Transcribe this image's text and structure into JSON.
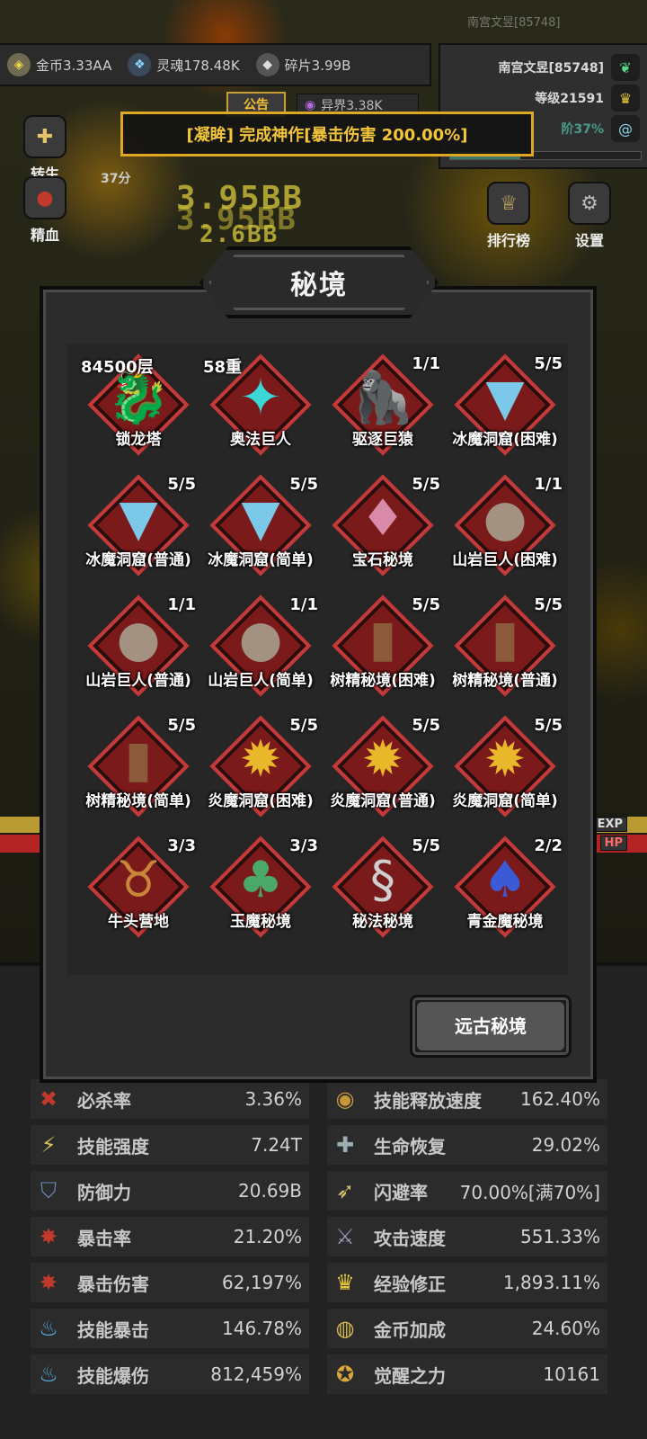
{
  "player": {
    "name_faint": "南宫文昱[85748]",
    "name": "南宫文昱[85748]",
    "level": "等级21591",
    "progress_label": "阶37%",
    "progress": 0.37
  },
  "resources": [
    {
      "label": "金币3.33AA",
      "icon": "coin-icon",
      "glyph": "◈"
    },
    {
      "label": "灵魂178.48K",
      "icon": "soul-icon",
      "glyph": "❖"
    },
    {
      "label": "碎片3.99B",
      "icon": "shard-icon",
      "glyph": "◆"
    }
  ],
  "notice_tab": "公告",
  "otherworld": "异界3.38K",
  "announcement": "[凝眸] 完成神作[暴击伤害 200.00%]",
  "side_left": [
    "转生",
    "精血"
  ],
  "side_left_sub": "37分",
  "side_right": [
    "排行榜",
    "设置"
  ],
  "strips": {
    "exp": "EXP",
    "hp": "HP"
  },
  "modal": {
    "title": "秘境",
    "button": "远古秘境"
  },
  "realms": [
    {
      "name": "锁龙塔",
      "count": "84500层",
      "glyph": "🐉",
      "color": "#4e5a2a",
      "left": true
    },
    {
      "name": "奥法巨人",
      "count": "58重",
      "glyph": "✦",
      "color": "#3bd6d6",
      "left": true
    },
    {
      "name": "驱逐巨猿",
      "count": "1/1",
      "glyph": "🦍",
      "color": "#888"
    },
    {
      "name": "冰魔洞窟(困难)",
      "count": "5/5",
      "glyph": "▼",
      "color": "#7cc8e8"
    },
    {
      "name": "冰魔洞窟(普通)",
      "count": "5/5",
      "glyph": "▼",
      "color": "#7cc8e8"
    },
    {
      "name": "冰魔洞窟(简单)",
      "count": "5/5",
      "glyph": "▼",
      "color": "#7cc8e8"
    },
    {
      "name": "宝石秘境",
      "count": "5/5",
      "glyph": "♦",
      "color": "#d98aa8"
    },
    {
      "name": "山岩巨人(困难)",
      "count": "1/1",
      "glyph": "●",
      "color": "#a39282"
    },
    {
      "name": "山岩巨人(普通)",
      "count": "1/1",
      "glyph": "●",
      "color": "#a39282"
    },
    {
      "name": "山岩巨人(简单)",
      "count": "1/1",
      "glyph": "●",
      "color": "#a39282"
    },
    {
      "name": "树精秘境(困难)",
      "count": "5/5",
      "glyph": "▮",
      "color": "#8a5a3a"
    },
    {
      "name": "树精秘境(普通)",
      "count": "5/5",
      "glyph": "▮",
      "color": "#8a5a3a"
    },
    {
      "name": "树精秘境(简单)",
      "count": "5/5",
      "glyph": "▮",
      "color": "#8a5a3a"
    },
    {
      "name": "炎魔洞窟(困难)",
      "count": "5/5",
      "glyph": "✹",
      "color": "#e8b82a"
    },
    {
      "name": "炎魔洞窟(普通)",
      "count": "5/5",
      "glyph": "✹",
      "color": "#e8b82a"
    },
    {
      "name": "炎魔洞窟(简单)",
      "count": "5/5",
      "glyph": "✹",
      "color": "#e8b82a"
    },
    {
      "name": "牛头营地",
      "count": "3/3",
      "glyph": "♉",
      "color": "#c8863a"
    },
    {
      "name": "玉魔秘境",
      "count": "3/3",
      "glyph": "♣",
      "color": "#4aa86a"
    },
    {
      "name": "秘法秘境",
      "count": "5/5",
      "glyph": "§",
      "color": "#cfcfcf"
    },
    {
      "name": "青金魔秘境",
      "count": "2/2",
      "glyph": "♠",
      "color": "#3a5ad6"
    }
  ],
  "stats_left": [
    {
      "label": "必杀率",
      "value": "3.36%",
      "glyph": "✖",
      "color": "#c0392b",
      "icon": "crit-kill-icon"
    },
    {
      "label": "技能强度",
      "value": "7.24T",
      "glyph": "⚡",
      "color": "#d4c25a",
      "icon": "skill-power-icon"
    },
    {
      "label": "防御力",
      "value": "20.69B",
      "glyph": "⛉",
      "color": "#6a8ab8",
      "icon": "shield-icon"
    },
    {
      "label": "暴击率",
      "value": "21.20%",
      "glyph": "✸",
      "color": "#c0392b",
      "icon": "crit-rate-icon"
    },
    {
      "label": "暴击伤害",
      "value": "62,197%",
      "glyph": "✸",
      "color": "#c0392b",
      "icon": "crit-damage-icon"
    },
    {
      "label": "技能暴击",
      "value": "146.78%",
      "glyph": "♨",
      "color": "#5ab4e8",
      "icon": "skill-crit-icon"
    },
    {
      "label": "技能爆伤",
      "value": "812,459%",
      "glyph": "♨",
      "color": "#5ab4e8",
      "icon": "skill-crit-damage-icon"
    }
  ],
  "stats_right": [
    {
      "label": "技能释放速度",
      "value": "162.40%",
      "glyph": "◉",
      "color": "#c8963a",
      "icon": "cast-speed-icon"
    },
    {
      "label": "生命恢复",
      "value": "29.02%",
      "glyph": "✚",
      "color": "#9ab0b0",
      "icon": "regen-icon"
    },
    {
      "label": "闪避率",
      "value": "70.00%[满70%]",
      "glyph": "➶",
      "color": "#d8c26a",
      "icon": "dodge-icon"
    },
    {
      "label": "攻击速度",
      "value": "551.33%",
      "glyph": "⚔",
      "color": "#9a9ab8",
      "icon": "attack-speed-icon"
    },
    {
      "label": "经验修正",
      "value": "1,893.11%",
      "glyph": "♛",
      "color": "#e8c83a",
      "icon": "crown-icon"
    },
    {
      "label": "金币加成",
      "value": "24.60%",
      "glyph": "◍",
      "color": "#d8b84a",
      "icon": "coin-bonus-icon"
    },
    {
      "label": "觉醒之力",
      "value": "10161",
      "glyph": "✪",
      "color": "#d8a83a",
      "icon": "awaken-icon"
    }
  ],
  "bg_numbers": [
    "3.95BB",
    "2.6BB",
    "3.95BB"
  ]
}
